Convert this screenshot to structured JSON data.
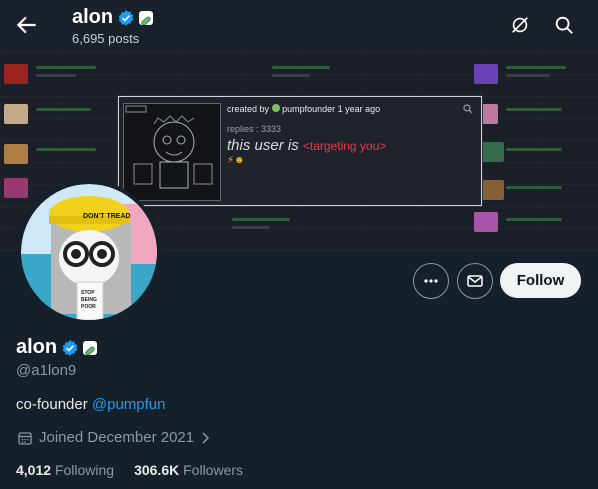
{
  "header": {
    "name": "alon",
    "posts_count": "6,695 posts"
  },
  "banner_card": {
    "created_by_label": "created by",
    "creator": "pumpfounder",
    "time_ago": "1 year ago",
    "replies": "replies : 3333",
    "main_text": "this user is",
    "highlight_text": "<targeting you>"
  },
  "profile": {
    "display_name": "alon",
    "handle": "@a1lon9",
    "bio_prefix": "co-founder",
    "bio_mention": "@pumpfun",
    "joined": "Joined December 2021",
    "following_count": "4,012",
    "following_label": "Following",
    "followers_count": "306.6K",
    "followers_label": "Followers"
  },
  "actions": {
    "follow_label": "Follow",
    "more_icon": "more-dots-icon",
    "message_icon": "envelope-icon"
  },
  "colors": {
    "background": "#15202b",
    "accent": "#1d9bf0",
    "follow_bg": "#eff3f4",
    "highlight_red": "#e63946"
  }
}
